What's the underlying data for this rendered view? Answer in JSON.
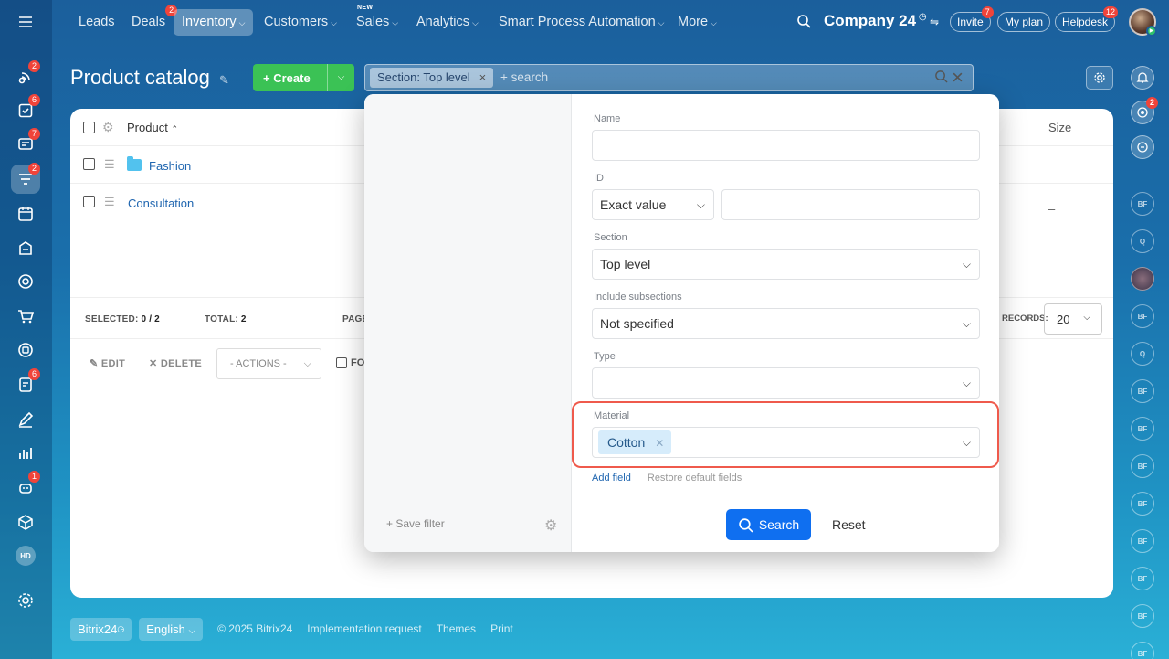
{
  "topnav": {
    "items": [
      {
        "label": "Leads"
      },
      {
        "label": "Deals",
        "badge": "2"
      },
      {
        "label": "Inventory",
        "active": true
      },
      {
        "label": "Customers"
      },
      {
        "label": "Sales",
        "tag": "NEW"
      },
      {
        "label": "Analytics"
      },
      {
        "label": "Smart Process Automation"
      },
      {
        "label": "More"
      }
    ],
    "company": "Company 24",
    "invite": "Invite",
    "invite_badge": "7",
    "my_plan": "My plan",
    "helpdesk": "Helpdesk",
    "helpdesk_badge": "12"
  },
  "leftbar": {
    "badges": [
      "2",
      "6",
      "7",
      "2",
      "6",
      "1"
    ],
    "hd_label": "HD"
  },
  "rightbar": {
    "badge": "2",
    "initials": [
      "BF",
      "Q",
      "BF",
      "Q",
      "BF",
      "BF",
      "BF",
      "BF",
      "BF",
      "BF",
      "BF",
      "BF",
      "BF"
    ]
  },
  "header": {
    "title": "Product catalog",
    "create_label": "Create",
    "filter_chip": "Section: Top level",
    "search_placeholder": "+ search"
  },
  "table": {
    "col_product": "Product",
    "col_size": "Size",
    "rows": [
      {
        "name": "Fashion",
        "type": "folder"
      },
      {
        "name": "Consultation",
        "size": "–"
      }
    ],
    "selected_label": "SELECTED:",
    "selected_value": "0 / 2",
    "total_label": "TOTAL:",
    "total_value": "2",
    "page_label": "PAGE",
    "records_label": "RECORDS:",
    "records_value": "20",
    "edit": "EDIT",
    "delete": "DELETE",
    "actions": "- ACTIONS -",
    "for_all": "FO"
  },
  "filter": {
    "name_label": "Name",
    "name_value": "",
    "id_label": "ID",
    "id_mode": "Exact value",
    "id_value": "",
    "section_label": "Section",
    "section_value": "Top level",
    "subsections_label": "Include subsections",
    "subsections_value": "Not specified",
    "type_label": "Type",
    "type_value": "",
    "material_label": "Material",
    "material_tag": "Cotton",
    "add_field": "Add field",
    "restore": "Restore default fields",
    "save_filter": "Save filter",
    "search_btn": "Search",
    "reset_btn": "Reset"
  },
  "footer": {
    "brand": "Bitrix24",
    "language": "English",
    "copyright": "© 2025 Bitrix24",
    "implementation": "Implementation request",
    "themes": "Themes",
    "print": "Print"
  }
}
